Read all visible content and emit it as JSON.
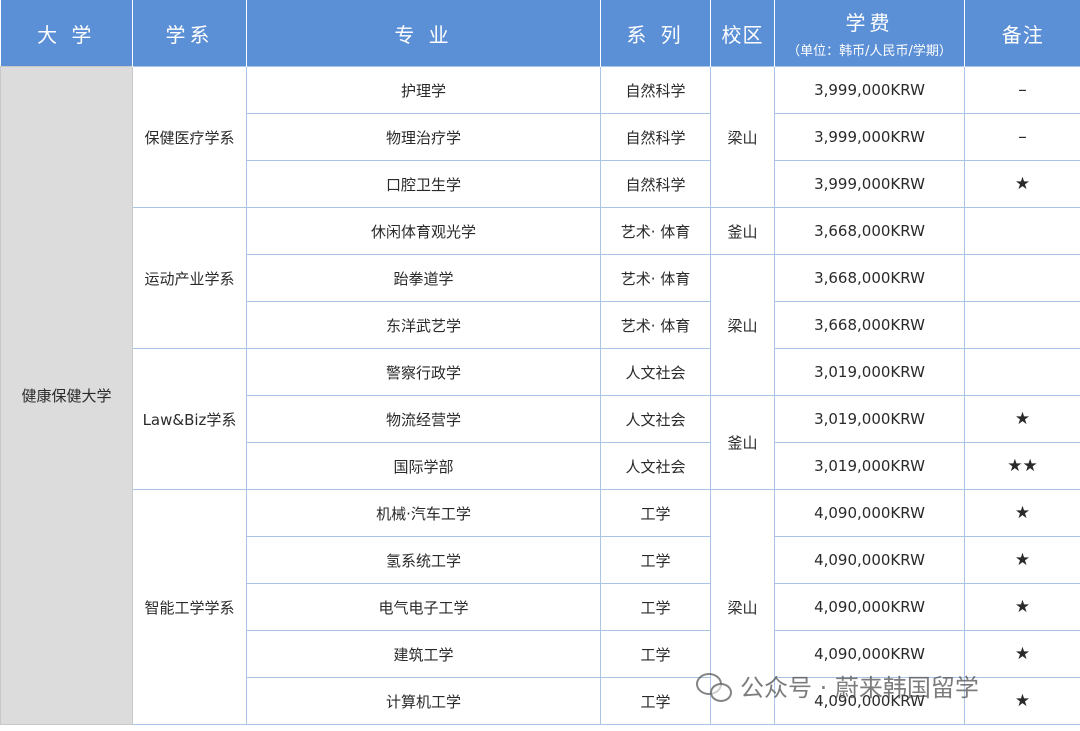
{
  "headers": {
    "university": "大 学",
    "department": "学系",
    "major": "专 业",
    "category": "系 列",
    "campus": "校区",
    "fee": "学费",
    "fee_unit": "（单位：韩币/人民币/学期）",
    "note": "备注"
  },
  "university": "健康保健大学",
  "departments": [
    "保健医疗学系",
    "运动产业学系",
    "Law&Biz学系",
    "智能工学学系"
  ],
  "campuses": [
    "梁山",
    "釜山",
    "梁山",
    "釜山",
    "梁山"
  ],
  "rows": [
    {
      "major": "护理学",
      "category": "自然科学",
      "fee": "3,999,000KRW",
      "note": "–"
    },
    {
      "major": "物理治疗学",
      "category": "自然科学",
      "fee": "3,999,000KRW",
      "note": "–"
    },
    {
      "major": "口腔卫生学",
      "category": "自然科学",
      "fee": "3,999,000KRW",
      "note": "★"
    },
    {
      "major": "休闲体育观光学",
      "category": "艺术· 体育",
      "fee": "3,668,000KRW",
      "note": ""
    },
    {
      "major": "跆拳道学",
      "category": "艺术· 体育",
      "fee": "3,668,000KRW",
      "note": ""
    },
    {
      "major": "东洋武艺学",
      "category": "艺术· 体育",
      "fee": "3,668,000KRW",
      "note": ""
    },
    {
      "major": "警察行政学",
      "category": "人文社会",
      "fee": "3,019,000KRW",
      "note": ""
    },
    {
      "major": "物流经营学",
      "category": "人文社会",
      "fee": "3,019,000KRW",
      "note": "★"
    },
    {
      "major": "国际学部",
      "category": "人文社会",
      "fee": "3,019,000KRW",
      "note": "★★"
    },
    {
      "major": "机械·汽车工学",
      "category": "工学",
      "fee": "4,090,000KRW",
      "note": "★"
    },
    {
      "major": "氢系统工学",
      "category": "工学",
      "fee": "4,090,000KRW",
      "note": "★"
    },
    {
      "major": "电气电子工学",
      "category": "工学",
      "fee": "4,090,000KRW",
      "note": "★"
    },
    {
      "major": "建筑工学",
      "category": "工学",
      "fee": "4,090,000KRW",
      "note": "★"
    },
    {
      "major": "计算机工学",
      "category": "工学",
      "fee": "4,090,000KRW",
      "note": "★"
    }
  ],
  "watermark": "公众号 · 蔚来韩国留学"
}
